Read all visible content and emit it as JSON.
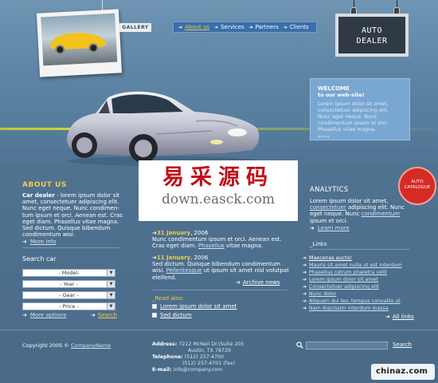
{
  "header": {
    "gallery_label": "GALLERY",
    "nav": [
      {
        "label": "About us",
        "active": true
      },
      {
        "label": "Services",
        "active": false
      },
      {
        "label": "Partners",
        "active": false
      },
      {
        "label": "Clients",
        "active": false
      }
    ],
    "sign_line1": "AUTO",
    "sign_line2": "DEALER"
  },
  "welcome": {
    "title": "WELCOME",
    "subtitle": "to our web-site!",
    "body": "Lorem ipsum dolor sit amet, consectetuer adipiscing elit. Nunc eget neque. Nunc condimentum ipsum et orci. Phasellus vitae magna.",
    "more": "»»»»"
  },
  "watermark": {
    "chinese": "易采源码",
    "domain": "down.easck.com"
  },
  "badge": {
    "line1": "AUTO",
    "line2": "CATALOGUE"
  },
  "about": {
    "heading": "ABOUT US",
    "lead": "Car dealer",
    "body": " - lorem ipsum dolor sit amet, consectetuer adipiscing elit. Nunc eget neque. Nunc condimen-tum ipsum et orci. Aenean est. Cras eget diam. Phasellus vitae magna. Sed dictum. Quisque bibendum condimentum wisi.",
    "more": "More info"
  },
  "search": {
    "heading": "Search car",
    "selects": [
      "- Model-",
      "- Year -",
      "- Gear -",
      "- Price -"
    ],
    "more_options": "More options",
    "button": "Search"
  },
  "news": [
    {
      "date": "31 January",
      "year": ", 2006",
      "text_before": "Nunc condimentum ipsum et orci. Aenean est. Cras eget diam. ",
      "link": "Phasellus",
      "text_after": " vitae magna."
    },
    {
      "date": "11 January",
      "year": ", 2006",
      "text_before": "Sed dictum. Quisque bibendum condimentum wisi. ",
      "link": "Pellentesque",
      "text_after": " ut ipsum sit amet nisl volutpat eleifend."
    }
  ],
  "archive_label": "Archive news",
  "read_also": {
    "heading": "_Read also:",
    "items": [
      "Lorem ipsum dolor sit amet",
      "Sed dictum"
    ]
  },
  "analytics": {
    "heading": "ANALYTICS",
    "text_before": "Lorem ipsum dolor sit amet, ",
    "link1": "consectetuer",
    "text_mid": " adipiscing elit. Nunc eget neque. Nunc ",
    "link2": "condimentum",
    "text_after": " ipsum et orci.",
    "more": "Learn more"
  },
  "links": {
    "heading": "_Links",
    "items": [
      "Maecenas auctor",
      "Mauris sit amet nulla ut est interdum",
      "Phasellus rutrum pharetra velit",
      "Lorem ipsum dolor sit amet",
      "Consectetuer adipiscing elit",
      "Nunc dolor",
      "Aliquam dui leo, tempus  convallis ut",
      "Nam dignissim interdum massa"
    ],
    "all": "All links"
  },
  "footer": {
    "copyright": "Copyright 2005 © ",
    "company": "CompanyName",
    "address_label": "Address:",
    "address_1": "7212 McNeil Dr.\\Suite 205",
    "address_2": "Austin, TX 78729",
    "telephone_label": "Telephone:",
    "telephone_1": "(512) 257-4700",
    "telephone_2": "(512) 257-4701 (fax)",
    "email_label": "E-mail:",
    "email": "info@company.com",
    "search_button": "Search",
    "site_mark": "chinaz.com"
  },
  "colors": {
    "accent_yellow": "#f2c94c",
    "nav_blue": "#3a6fa8",
    "badge_red": "#d52b23"
  }
}
